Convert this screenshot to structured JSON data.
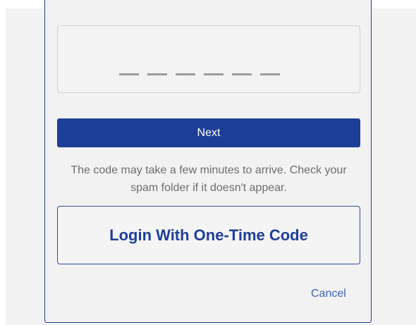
{
  "verification": {
    "code_input": {
      "value": "",
      "slots": 6
    },
    "next_label": "Next",
    "help_text": "The code may take a few minutes to arrive. Check your spam folder if it doesn't appear.",
    "otp_button_label": "Login With One-Time Code",
    "cancel_label": "Cancel"
  },
  "colors": {
    "primary": "#1e3f97",
    "link": "#3c63b4",
    "background": "#f2f2f2",
    "help_text": "#6d6d6d"
  }
}
